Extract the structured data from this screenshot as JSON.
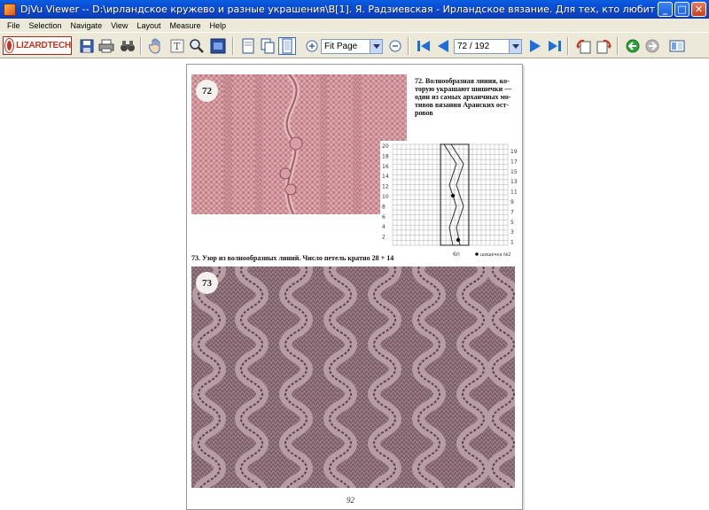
{
  "window": {
    "title": "DjVu Viewer -- D:\\ирландское кружево и разные украшения\\В[1]. Я. Радзиевская - Ирландское вязание. Для тех, кто любит вязать.djvu",
    "minimize": "_",
    "maximize": "□",
    "close": "✕"
  },
  "menu": {
    "items": [
      "File",
      "Selection",
      "Navigate",
      "View",
      "Layout",
      "Measure",
      "Help"
    ]
  },
  "toolbar": {
    "logo_text": "LIZARDTECH",
    "zoom_value": "Fit Page",
    "page_value": "72 / 192",
    "icons": {
      "save": "save-icon",
      "print": "print-icon",
      "find": "binoculars-icon",
      "hand": "hand-icon",
      "text_select": "text-select-icon",
      "zoom_tool": "zoom-tool-icon",
      "snapshot": "snapshot-icon",
      "single_page": "single-page-icon",
      "continuous": "continuous-page-icon",
      "zoom_in": "zoom-in-icon",
      "zoom_out": "zoom-out-icon",
      "first_page": "first-page-icon",
      "prev_page": "prev-page-icon",
      "next_page": "next-page-icon",
      "last_page": "last-page-icon",
      "rotate_left": "rotate-left-icon",
      "rotate_right": "rotate-right-icon",
      "back": "back-icon",
      "forward": "forward-icon",
      "thumbnails": "thumbnails-icon"
    },
    "colors": {
      "logo_red": "#c8321e",
      "nav_blue": "#1c6ed8",
      "back_green": "#2aa33a"
    }
  },
  "document": {
    "fig72_badge": "72",
    "fig72_caption_lines": [
      "72. Волнообразная линия, ко-",
      "торую украшают шишечки —",
      "один из самых архаичных мо-",
      "тивов вязания Аранских ост-",
      "ровов"
    ],
    "chart_left_labels": [
      "20",
      "18",
      "16",
      "14",
      "12",
      "10",
      "8",
      "6",
      "4",
      "2"
    ],
    "chart_right_labels": [
      "19",
      "17",
      "15",
      "13",
      "11",
      "9",
      "7",
      "5",
      "3",
      "1"
    ],
    "chart_bottom_label": "6п",
    "chart_legend": "шишечка №2",
    "fig73_caption": "73. Узор из волнообразных линий. Число петель кратно 28 + 14",
    "fig73_badge": "73",
    "page_number": "92",
    "colors": {
      "knit_pink": "#c98b92",
      "knit_gray": "#8d6f78"
    }
  }
}
